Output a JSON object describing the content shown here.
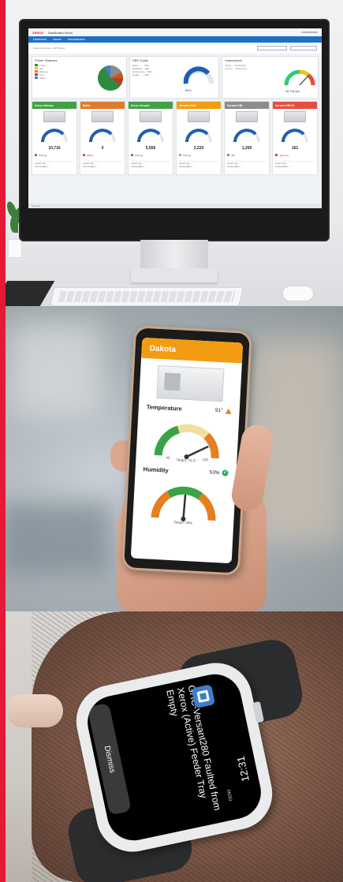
{
  "desktop": {
    "app_brand": "XEROX",
    "app_title": "Dashboard Xerox",
    "user_menu": "Administrator",
    "nav": [
      "Dashboard",
      "Assets",
      "Administration"
    ],
    "filter_text": "Select all printers - 24 Printers",
    "fleet_card_title": "Printer Statuses",
    "fleet_legend": [
      "Active",
      "Idle",
      "Warning",
      "Error",
      "Offline"
    ],
    "oee_card_title": "OEE Goals",
    "oee_value": "85%",
    "impr_card_title": "Impressions",
    "impr_value": "30,715 sph",
    "devices": [
      {
        "name": "Xerox Iridesse",
        "color": "#43a047",
        "value": "10,716",
        "status": "Printing",
        "status_color": "#2e7d32"
      },
      {
        "name": "Baltic",
        "color": "#e07a2c",
        "value": "0",
        "status": "Offline",
        "status_color": "#c62828"
      },
      {
        "name": "Xerox Versant",
        "color": "#43a047",
        "value": "5,556",
        "status": "Printing",
        "status_color": "#2e7d32"
      },
      {
        "name": "Versant 4100",
        "color": "#f39c12",
        "value": "2,220",
        "status": "Printing",
        "status_color": "#e67e22"
      },
      {
        "name": "Versant 180",
        "color": "#8c8c8c",
        "value": "1,200",
        "status": "Idle",
        "status_color": "#777777"
      },
      {
        "name": "Versant 280CX",
        "color": "#e74c3c",
        "value": "161",
        "status": "Jammed",
        "status_color": "#c62828"
      }
    ],
    "status_footer": "Show all"
  },
  "phone": {
    "title": "Dakota",
    "temperature_label": "Temperature",
    "temperature_value": "91°",
    "temperature_target": "Target: 75.0°",
    "humidity_label": "Humidity",
    "humidity_value": "53%",
    "humidity_target": "Target: 50%",
    "accent_color": "#f39c12"
  },
  "watch": {
    "time": "12:31",
    "when": "now",
    "message": "GHC-Versant280 Faulted from Xerox (Active) Feeder Tray Empty",
    "dismiss": "Dismiss",
    "app_icon": "xerox-app-icon"
  }
}
